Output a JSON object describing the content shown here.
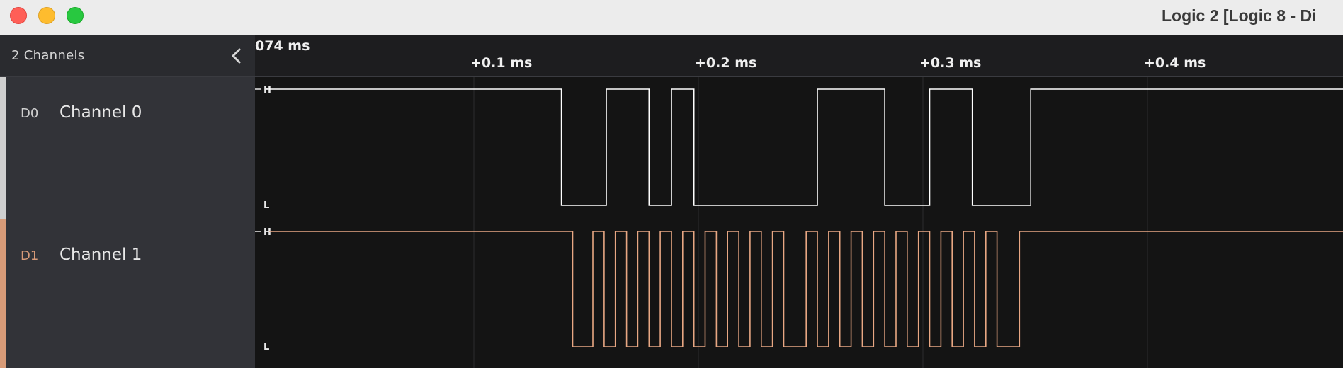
{
  "window": {
    "title": "Logic 2 [Logic 8 - Di"
  },
  "sidebar": {
    "channel_count_label": "2 Channels",
    "collapse_icon": "chevron-left-icon"
  },
  "timeline": {
    "origin_label": "074 ms",
    "ticks": [
      "+0.1 ms",
      "+0.2 ms",
      "+0.3 ms",
      "+0.4 ms"
    ]
  },
  "channels": [
    {
      "tag": "D0",
      "name": "Channel 0",
      "color": "#ffffff",
      "tag_color": "#cfcfcf",
      "high_label": "H",
      "low_label": "L",
      "initial_level": "H",
      "transitions_ms": [
        0.139,
        0.159,
        0.178,
        0.188,
        0.198,
        0.253,
        0.283,
        0.303,
        0.322,
        0.348
      ]
    },
    {
      "tag": "D1",
      "name": "Channel 1",
      "color": "#e8a783",
      "tag_color": "#d89b78",
      "high_label": "H",
      "low_label": "L",
      "initial_level": "H",
      "transitions_ms": [
        0.144,
        0.153,
        0.158,
        0.163,
        0.168,
        0.173,
        0.178,
        0.183,
        0.188,
        0.193,
        0.198,
        0.203,
        0.208,
        0.213,
        0.218,
        0.223,
        0.228,
        0.233,
        0.238,
        0.248,
        0.253,
        0.258,
        0.263,
        0.268,
        0.273,
        0.278,
        0.283,
        0.288,
        0.293,
        0.298,
        0.303,
        0.308,
        0.313,
        0.318,
        0.323,
        0.328,
        0.333,
        0.343
      ]
    }
  ]
}
